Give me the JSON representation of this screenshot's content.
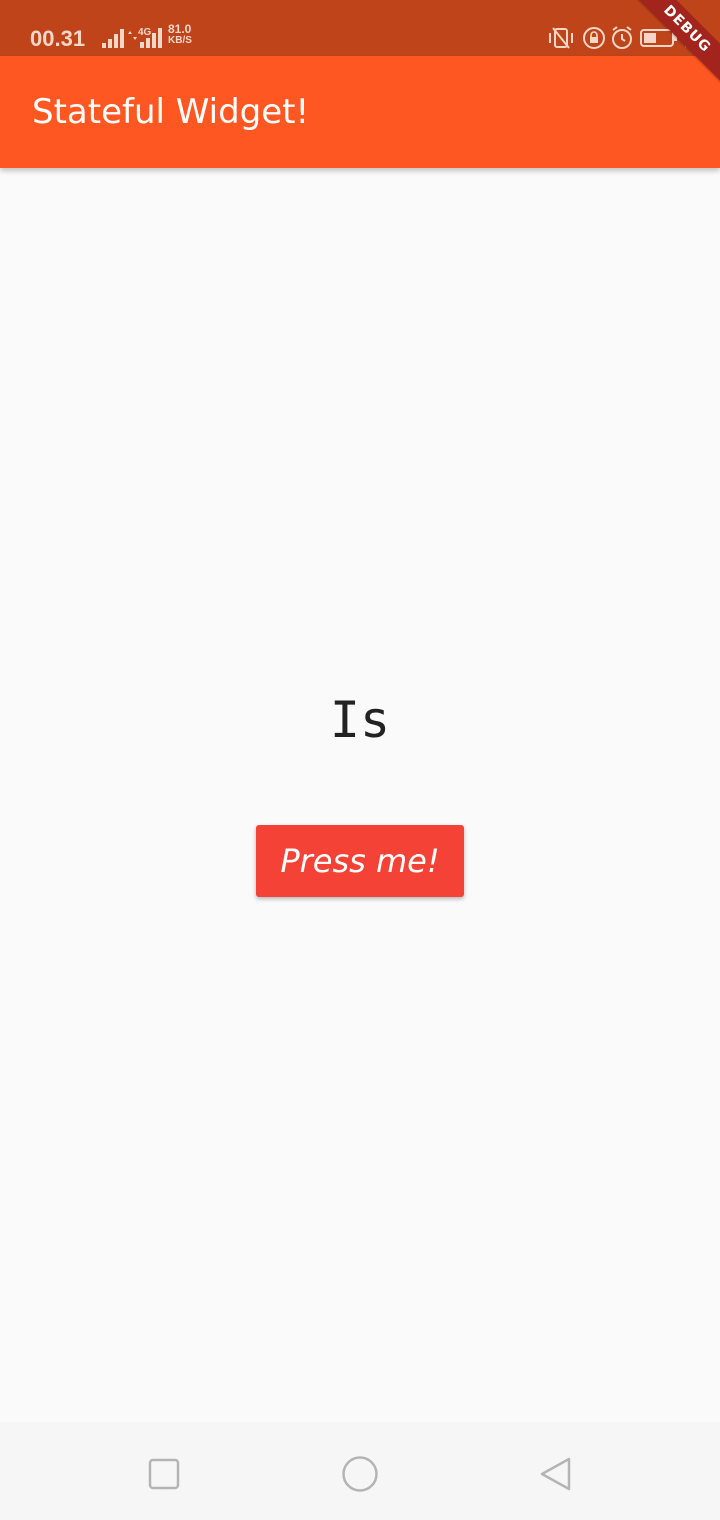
{
  "status_bar": {
    "time": "00.31",
    "network_type": "4G",
    "speed_value": "81.0",
    "speed_unit": "KB/S",
    "icons": [
      "signal-icon",
      "signal-4g-icon",
      "vibrate-icon",
      "lock-rotation-icon",
      "alarm-icon",
      "battery-icon",
      "charging-icon"
    ]
  },
  "debug_banner": {
    "label": "DEBUG"
  },
  "app_bar": {
    "title": "Stateful Widget!"
  },
  "main": {
    "label": "Is",
    "button_label": "Press me!"
  },
  "nav_bar": {
    "icons": [
      "recent-apps-icon",
      "home-icon",
      "back-icon"
    ]
  },
  "colors": {
    "status_bar": "#bf441a",
    "app_bar": "#ff5722",
    "button": "#f44336",
    "background": "#fafafa",
    "debug_banner": "#a3241c"
  }
}
